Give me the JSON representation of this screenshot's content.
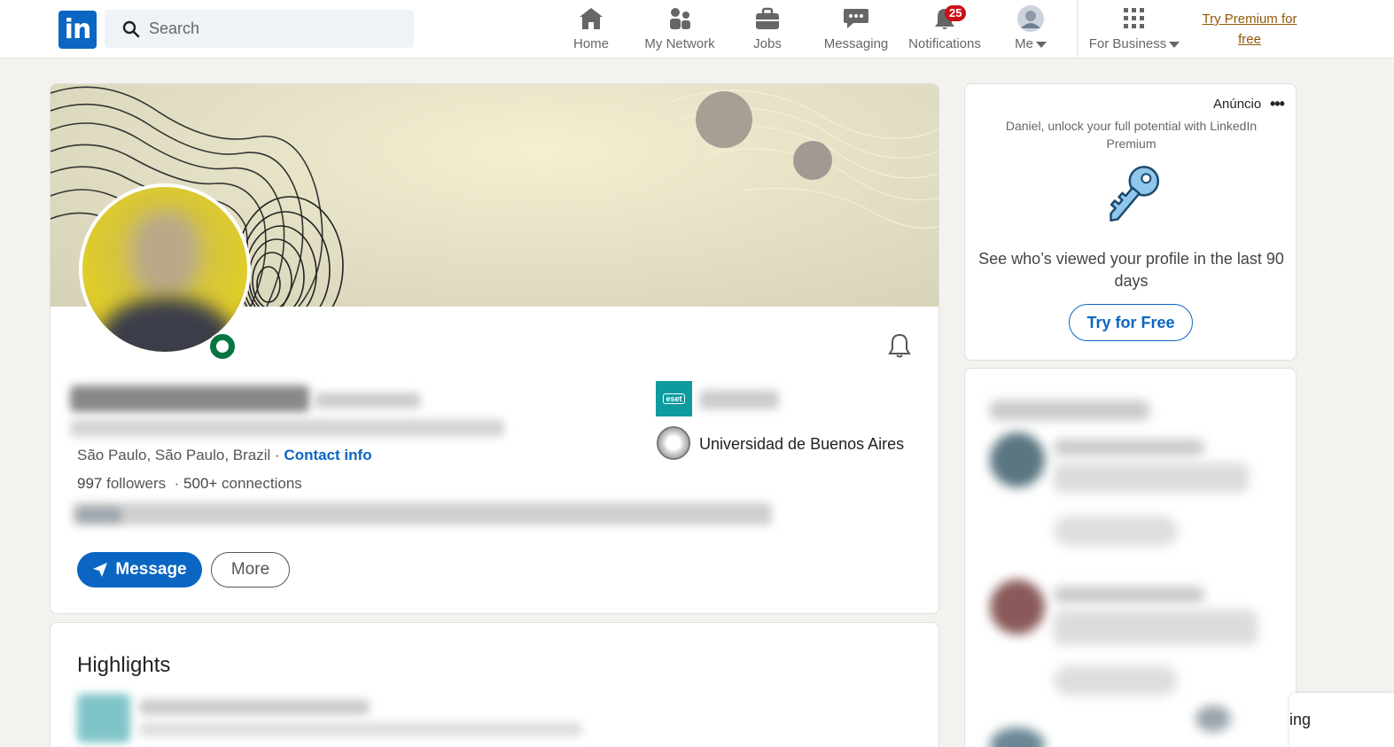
{
  "nav": {
    "search_placeholder": "Search",
    "items": [
      {
        "label": "Home",
        "icon": "home-icon"
      },
      {
        "label": "My Network",
        "icon": "network-icon"
      },
      {
        "label": "Jobs",
        "icon": "briefcase-icon"
      },
      {
        "label": "Messaging",
        "icon": "chat-icon"
      },
      {
        "label": "Notifications",
        "icon": "bell-icon",
        "badge": "25"
      },
      {
        "label": "Me",
        "icon": "avatar-icon"
      },
      {
        "label": "For Business",
        "icon": "grid-icon"
      }
    ],
    "premium_link": "Try Premium for free",
    "colors": {
      "brand": "#0a66c2",
      "badge": "#cc1016",
      "premium": "#915907"
    }
  },
  "profile": {
    "location": "São Paulo, São Paulo, Brazil",
    "separator": " · ",
    "contact_info": "Contact info",
    "followers_count": "997",
    "followers_label": " followers",
    "connections_count": "500+",
    "connections_label": " connections",
    "message_button": "Message",
    "more_button": "More",
    "education": "Universidad de Buenos Aires",
    "company_logo_text": "eset"
  },
  "highlights": {
    "title": "Highlights"
  },
  "ad": {
    "label": "Anúncio",
    "menu": "•••",
    "subtitle": "Daniel, unlock your full potential with LinkedIn Premium",
    "headline": "See who’s viewed your profile in the last 90 days",
    "button": "Try for Free"
  },
  "messaging_bar": {
    "label": "ing"
  }
}
